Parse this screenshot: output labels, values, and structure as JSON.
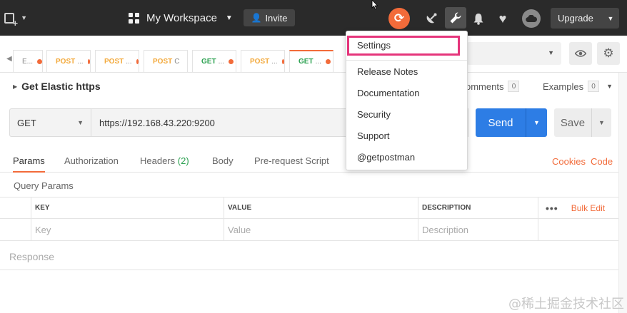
{
  "topbar": {
    "workspace_name": "My Workspace",
    "invite_label": "Invite",
    "upgrade_label": "Upgrade"
  },
  "tabs": [
    {
      "method": "",
      "title": "E..."
    },
    {
      "method": "POST",
      "title": "..."
    },
    {
      "method": "POST",
      "title": "..."
    },
    {
      "method": "POST",
      "title": "C"
    },
    {
      "method": "GET",
      "title": "..."
    },
    {
      "method": "POST",
      "title": "..."
    },
    {
      "method": "GET",
      "title": "..."
    }
  ],
  "request": {
    "name": "Get Elastic https",
    "comments_label": "omments",
    "comments_count": "0",
    "examples_label": "Examples",
    "examples_count": "0",
    "method": "GET",
    "url": "https://192.168.43.220:9200",
    "send_label": "Send",
    "save_label": "Save"
  },
  "subtabs": {
    "params": "Params",
    "authorization": "Authorization",
    "headers": "Headers",
    "headers_count": "(2)",
    "body": "Body",
    "prerequest": "Pre-request Script",
    "cookies": "Cookies",
    "code": "Code"
  },
  "params_table": {
    "section_title": "Query Params",
    "columns": {
      "key": "KEY",
      "value": "VALUE",
      "description": "DESCRIPTION"
    },
    "more": "•••",
    "bulk_edit": "Bulk Edit",
    "placeholders": {
      "key": "Key",
      "value": "Value",
      "description": "Description"
    }
  },
  "response_label": "Response",
  "settings_menu": {
    "items": [
      "Settings",
      "Release Notes",
      "Documentation",
      "Security",
      "Support",
      "@getpostman"
    ]
  },
  "watermark": "@稀土掘金技术社区",
  "colors": {
    "accent_orange": "#f26b3a",
    "send_blue": "#2d7de5",
    "highlight_pink": "#e5357b",
    "get_green": "#2aa04f",
    "post_yellow": "#f3a93b"
  }
}
